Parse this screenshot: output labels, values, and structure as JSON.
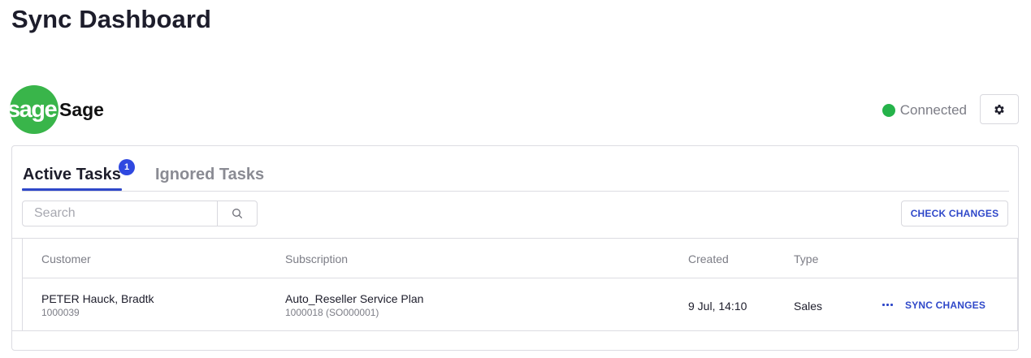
{
  "page": {
    "title": "Sync Dashboard"
  },
  "integration": {
    "logo_text": "sage",
    "name": "Sage",
    "status": "Connected",
    "status_color": "#25b34a",
    "brand_color": "#39b54a",
    "settings_icon": "gear-icon"
  },
  "tabs": [
    {
      "label": "Active Tasks",
      "badge": "1",
      "active": true
    },
    {
      "label": "Ignored Tasks",
      "active": false
    }
  ],
  "search": {
    "placeholder": "Search",
    "value": "",
    "icon": "search-icon"
  },
  "actions": {
    "check_changes": "CHECK CHANGES"
  },
  "table": {
    "headers": [
      "Customer",
      "Subscription",
      "Created",
      "Type"
    ],
    "rows": [
      {
        "customer_name": "PETER Hauck, Bradtk",
        "customer_id": "1000039",
        "subscription_name": "Auto_Reseller Service Plan",
        "subscription_id": "1000018 (SO000001)",
        "created": "9 Jul, 14:10",
        "type": "Sales",
        "menu_icon": "more-dots-icon",
        "action": "SYNC CHANGES"
      }
    ]
  },
  "accent_color": "#2f48c9"
}
